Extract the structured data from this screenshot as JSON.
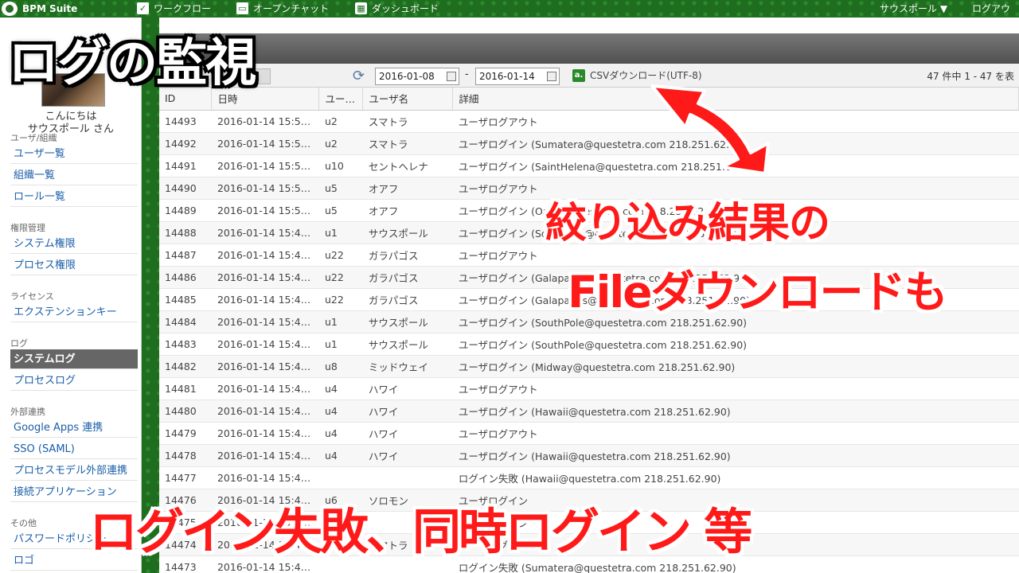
{
  "topbar": {
    "logo": "BPM Suite",
    "nav": [
      {
        "label": "ワークフロー",
        "icon": "check-icon"
      },
      {
        "label": "オープンチャット",
        "icon": "chat-icon"
      },
      {
        "label": "ダッシュボード",
        "icon": "dashboard-icon"
      }
    ],
    "user_menu": "サウスポール ▼",
    "logout": "ログアウト"
  },
  "sidebar": {
    "greeting_line1": "こんにちは",
    "greeting_line2": "サウスポール さん",
    "sections": [
      {
        "title": "ユーザ/組織",
        "items": [
          "ユーザ一覧",
          "組織一覧",
          "ロール一覧"
        ]
      },
      {
        "title": "権限管理",
        "items": [
          "システム権限",
          "プロセス権限"
        ]
      },
      {
        "title": "ライセンス",
        "items": [
          "エクステンションキー"
        ]
      },
      {
        "title": "ログ",
        "items": [
          "システムログ",
          "プロセスログ"
        ]
      },
      {
        "title": "外部連携",
        "items": [
          "Google Apps 連携",
          "SSO (SAML)",
          "プロセスモデル外部連携",
          "接続アプリケーション"
        ]
      },
      {
        "title": "その他",
        "items": [
          "パスワードポリシー",
          "ロゴ"
        ]
      }
    ],
    "active_item": "システムログ"
  },
  "toolbar": {
    "date_from": "2016-01-08",
    "date_separator": "-",
    "date_to": "2016-01-14",
    "csv_icon_text": "a.",
    "csv_label": "CSVダウンロード(UTF-8)",
    "count": "47 件中 1 - 47 を表"
  },
  "table": {
    "headers": [
      "ID",
      "日時",
      "ユー…",
      "ユーザ名",
      "詳細"
    ],
    "rows": [
      [
        "14493",
        "2016-01-14 15:5…",
        "u2",
        "スマトラ",
        "ユーザログアウト"
      ],
      [
        "14492",
        "2016-01-14 15:5…",
        "u2",
        "スマトラ",
        "ユーザログイン (Sumatera@questetra.com 218.251.62.90)"
      ],
      [
        "14491",
        "2016-01-14 15:5…",
        "u10",
        "セントヘレナ",
        "ユーザログイン (SaintHelena@questetra.com 218.251.62.90)"
      ],
      [
        "14490",
        "2016-01-14 15:5…",
        "u5",
        "オアフ",
        "ユーザログアウト"
      ],
      [
        "14489",
        "2016-01-14 15:5…",
        "u5",
        "オアフ",
        "ユーザログイン (Oahu@questetra.com 218.251.62.90)"
      ],
      [
        "14488",
        "2016-01-14 15:4…",
        "u1",
        "サウスポール",
        "ユーザログイン (SouthPole@questetra.com 218.251.62.90)"
      ],
      [
        "14487",
        "2016-01-14 15:4…",
        "u22",
        "ガラパゴス",
        "ユーザログアウト"
      ],
      [
        "14486",
        "2016-01-14 15:4…",
        "u22",
        "ガラパゴス",
        "ユーザログイン (Galapagos@questetra.com 218.251.62.90)"
      ],
      [
        "14485",
        "2016-01-14 15:4…",
        "u22",
        "ガラパゴス",
        "ユーザログイン (Galapagos@questetra.com 218.251.62.90)"
      ],
      [
        "14484",
        "2016-01-14 15:4…",
        "u1",
        "サウスポール",
        "ユーザログイン (SouthPole@questetra.com 218.251.62.90)"
      ],
      [
        "14483",
        "2016-01-14 15:4…",
        "u1",
        "サウスポール",
        "ユーザログイン (SouthPole@questetra.com 218.251.62.90)"
      ],
      [
        "14482",
        "2016-01-14 15:4…",
        "u8",
        "ミッドウェイ",
        "ユーザログイン (Midway@questetra.com 218.251.62.90)"
      ],
      [
        "14481",
        "2016-01-14 15:4…",
        "u4",
        "ハワイ",
        "ユーザログアウト"
      ],
      [
        "14480",
        "2016-01-14 15:4…",
        "u4",
        "ハワイ",
        "ユーザログイン (Hawaii@questetra.com 218.251.62.90)"
      ],
      [
        "14479",
        "2016-01-14 15:4…",
        "u4",
        "ハワイ",
        "ユーザログアウト"
      ],
      [
        "14478",
        "2016-01-14 15:4…",
        "u4",
        "ハワイ",
        "ユーザログイン (Hawaii@questetra.com 218.251.62.90)"
      ],
      [
        "14477",
        "2016-01-14 15:4…",
        "",
        "",
        "ログイン失敗 (Hawaii@questetra.com 218.251.62.90)"
      ],
      [
        "14476",
        "2016-01-14 15:4…",
        "u6",
        "ソロモン",
        "ユーザログイン"
      ],
      [
        "14475",
        "2016-01-14 15:4…",
        "",
        "",
        "ユーザログイン"
      ],
      [
        "14474",
        "2016-01-14 15:4…",
        "u2",
        "スマトラ",
        "ユーザログイン"
      ],
      [
        "14473",
        "2016-01-14 15:4…",
        "",
        "",
        "ログイン失敗 (Sumatera@questetra.com 218.251.62.90)"
      ]
    ]
  },
  "overlays": {
    "title": "ログの監視",
    "callout_line1": "絞り込み結果の",
    "callout_line2": "Fileダウンロードも",
    "bottom": "ログイン失敗、同時ログイン 等"
  },
  "colors": {
    "background_green": "#1f6e1f",
    "overlay_red": "#ff1a1a",
    "active_item": "#666666",
    "link_blue": "#1a5ea8"
  }
}
